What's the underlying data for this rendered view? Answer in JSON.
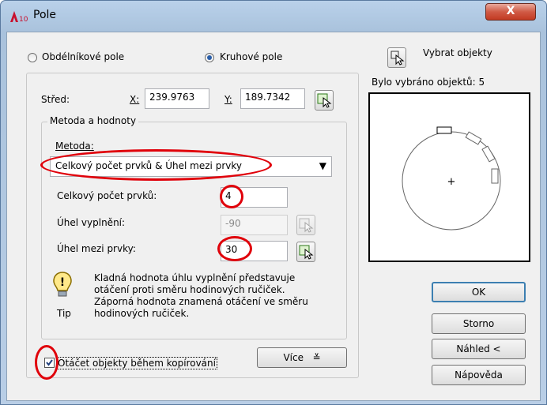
{
  "window": {
    "title": "Pole",
    "close_label": "X"
  },
  "mode": {
    "rect_label": "Obdélníkové pole",
    "polar_label": "Kruhové pole",
    "selected": "polar"
  },
  "select_objects": {
    "label": "Vybrat objekty",
    "status": "Bylo vybráno objektů: 5"
  },
  "center": {
    "label": "Střed:",
    "x_label": "X:",
    "x_value": "239.9763",
    "y_label": "Y:",
    "y_value": "189.7342"
  },
  "method_group": {
    "legend": "Metoda a hodnoty",
    "method_label": "Metoda:",
    "method_value": "Celkový počet prvků & Úhel mezi prvky",
    "total_label": "Celkový počet prvků:",
    "total_value": "4",
    "fill_label": "Úhel vyplnění:",
    "fill_value": "-90",
    "between_label": "Úhel mezi prvky:",
    "between_value": "30"
  },
  "tip": {
    "label": "Tip",
    "text_lines": [
      "Kladná hodnota úhlu vyplnění představuje",
      "otáčení proti směru hodinových ručiček.",
      "Záporná hodnota znamená otáčení ve směru",
      "hodinových ručiček."
    ]
  },
  "rotate_checkbox": {
    "label": "Otáčet objekty během kopírování",
    "checked": true
  },
  "more_button": {
    "label": "Více"
  },
  "buttons": {
    "ok": "OK",
    "cancel": "Storno",
    "preview": "Náhled <",
    "help": "Nápověda"
  },
  "colors": {
    "highlight": "#e0000a",
    "accent": "#2a5ea8"
  }
}
